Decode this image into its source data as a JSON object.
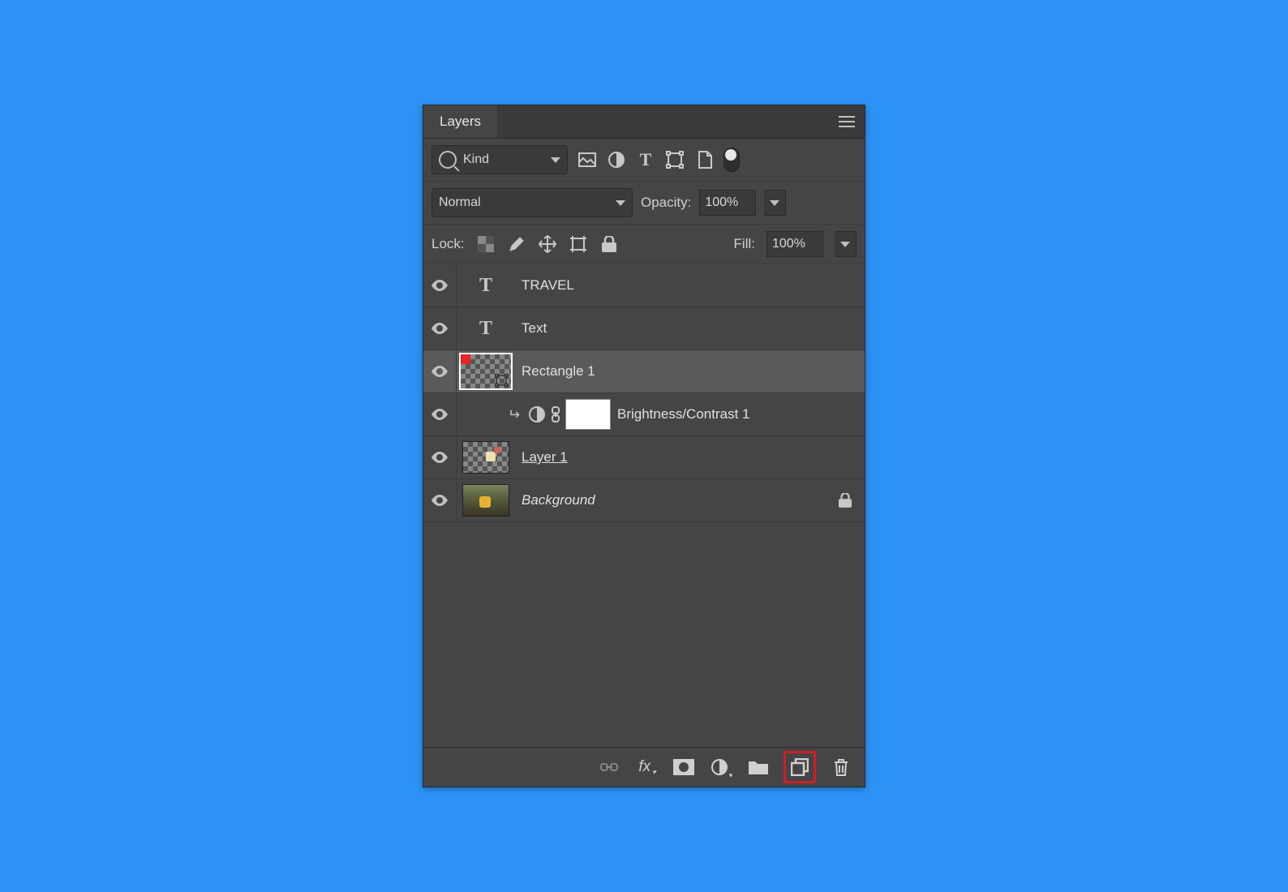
{
  "tab": {
    "title": "Layers"
  },
  "filter": {
    "kind": "Kind"
  },
  "blend": {
    "mode": "Normal",
    "opacity_label": "Opacity:",
    "opacity": "100%"
  },
  "lock": {
    "label": "Lock:",
    "fill_label": "Fill:",
    "fill": "100%"
  },
  "layers": [
    {
      "name": "TRAVEL",
      "type": "text"
    },
    {
      "name": "Text",
      "type": "text"
    },
    {
      "name": "Rectangle 1",
      "type": "shape",
      "selected": true
    },
    {
      "name": "Brightness/Contrast 1",
      "type": "adjustment",
      "clipped": true
    },
    {
      "name": "Layer 1",
      "type": "raster",
      "smart": true
    },
    {
      "name": "Background",
      "type": "bg",
      "locked": true
    }
  ]
}
